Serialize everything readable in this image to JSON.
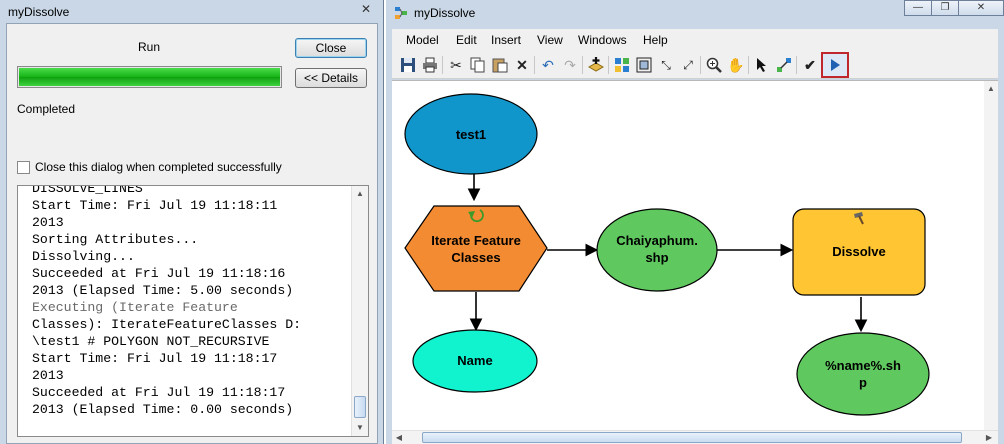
{
  "dialog": {
    "title": "myDissolve",
    "run_label": "Run",
    "close_button": "Close",
    "details_button": "<< Details",
    "progress_percent": 100,
    "status": "Completed",
    "close_when_completed_label": "Close this dialog when completed successfully",
    "close_when_completed_checked": false,
    "log": [
      {
        "text": "DISSOLVE_LINES",
        "type": "message"
      },
      {
        "text": "Start Time: Fri Jul 19 11:18:11",
        "type": "message"
      },
      {
        "text": "2013",
        "type": "message"
      },
      {
        "text": "Sorting Attributes...",
        "type": "message"
      },
      {
        "text": "Dissolving...",
        "type": "message"
      },
      {
        "text": "Succeeded at Fri Jul 19 11:18:16",
        "type": "message"
      },
      {
        "text": "2013 (Elapsed Time: 5.00 seconds)",
        "type": "message"
      },
      {
        "text": "Executing (Iterate Feature",
        "type": "info"
      },
      {
        "text": "Classes): IterateFeatureClasses D:",
        "type": "message"
      },
      {
        "text": "\\test1 # POLYGON NOT_RECURSIVE",
        "type": "message"
      },
      {
        "text": "Start Time: Fri Jul 19 11:18:17",
        "type": "message"
      },
      {
        "text": "2013",
        "type": "message"
      },
      {
        "text": "Succeeded at Fri Jul 19 11:18:17",
        "type": "message"
      },
      {
        "text": "2013 (Elapsed Time: 0.00 seconds)",
        "type": "message"
      }
    ]
  },
  "window": {
    "title": "myDissolve",
    "menu": [
      "Model",
      "Edit",
      "Insert",
      "View",
      "Windows",
      "Help"
    ],
    "toolbar_icons": [
      "save-icon",
      "print-icon",
      "cut-icon",
      "copy-icon",
      "paste-icon",
      "delete-icon",
      "undo-icon",
      "redo-icon",
      "add-data-icon",
      "auto-layout-icon",
      "full-extent-icon",
      "fixed-zoom-in-icon",
      "fixed-zoom-out-icon",
      "zoom-in-icon",
      "pan-icon",
      "select-icon",
      "connect-icon",
      "validate-icon",
      "run-icon"
    ]
  },
  "model": {
    "nodes": {
      "test1": {
        "label": "test1",
        "color": "#1196cc"
      },
      "iterate": {
        "label_lines": [
          "Iterate Feature",
          "Classes"
        ],
        "color": "#f38b33"
      },
      "chaiyaphum": {
        "label_lines": [
          "Chaiyaphum.",
          "shp"
        ],
        "color": "#5fc95f"
      },
      "dissolve": {
        "label": "Dissolve",
        "color": "#ffc533"
      },
      "name": {
        "label": "Name",
        "color": "#11f2cf"
      },
      "output": {
        "label_lines": [
          "%name%.sh",
          "p"
        ],
        "color": "#5fc95f"
      }
    }
  }
}
